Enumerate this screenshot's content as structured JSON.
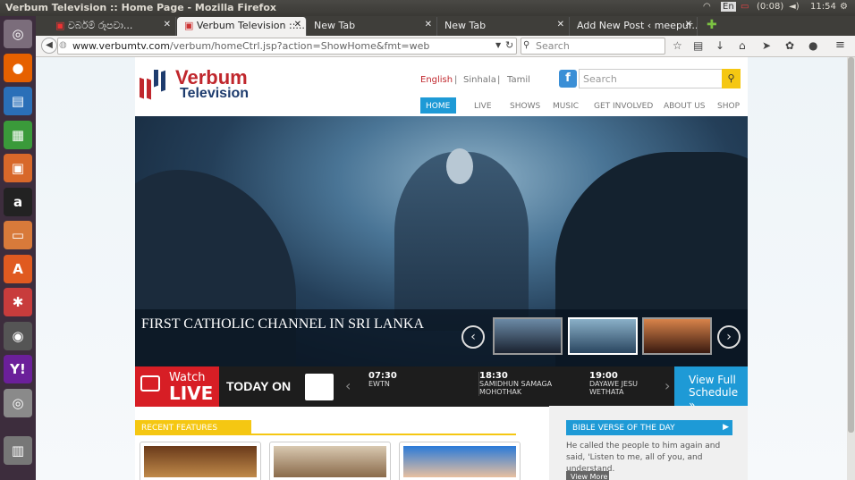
{
  "system": {
    "window_title": "Verbum Television :: Home Page - Mozilla Firefox",
    "keyboard": "En",
    "battery": "(0:08)",
    "time": "11:54"
  },
  "launcher": {
    "items": [
      {
        "icon": "ubuntu-dash-icon",
        "glyph": "◎",
        "color": "#7b6d7b"
      },
      {
        "icon": "firefox-icon",
        "glyph": "●",
        "color": "#e66000"
      },
      {
        "icon": "writer-icon",
        "glyph": "▤",
        "color": "#2a6fb8"
      },
      {
        "icon": "calc-icon",
        "glyph": "▦",
        "color": "#3a9a3a"
      },
      {
        "icon": "impress-icon",
        "glyph": "▣",
        "color": "#d8682a"
      },
      {
        "icon": "amazon-icon",
        "glyph": "a",
        "color": "#222222"
      },
      {
        "icon": "files-icon",
        "glyph": "▭",
        "color": "#d87a3a"
      },
      {
        "icon": "software-center-icon",
        "glyph": "A",
        "color": "#e05a20"
      },
      {
        "icon": "settings-icon",
        "glyph": "✱",
        "color": "#c83c3c"
      },
      {
        "icon": "webcam-icon",
        "glyph": "◉",
        "color": "#555555"
      },
      {
        "icon": "yahoo-mail-icon",
        "glyph": "Y!",
        "color": "#6b1f9a"
      },
      {
        "icon": "cdrom-icon",
        "glyph": "◎",
        "color": "#8a8a8a"
      },
      {
        "icon": "trash-icon",
        "glyph": "▥",
        "color": "#777777"
      }
    ]
  },
  "browser": {
    "tabs": [
      {
        "label": "වර්බම් රූපවා...",
        "active": false
      },
      {
        "label": "Verbum Television ::...",
        "active": true
      },
      {
        "label": "New Tab",
        "active": false
      },
      {
        "label": "New Tab",
        "active": false
      },
      {
        "label": "Add New Post ‹ meepur...",
        "active": false
      }
    ],
    "url_host": "www.verbumtv.com",
    "url_path": "/verbum/homeCtrl.jsp?action=ShowHome&fmt=web",
    "search_placeholder": "Search"
  },
  "site": {
    "logo_line1": "Verbum",
    "logo_line2": "Television",
    "languages": [
      "English",
      "Sinhala",
      "Tamil"
    ],
    "search_placeholder": "Search",
    "nav": [
      "HOME",
      "LIVE",
      "SHOWS",
      "MUSIC",
      "GET INVOLVED",
      "ABOUT US",
      "SHOP"
    ],
    "hero_title": "FIRST CATHOLIC CHANNEL IN SRI LANKA",
    "watch_label": "Watch",
    "live_label": "LIVE",
    "today_on": "TODAY ON",
    "schedule": [
      {
        "time": "07:30",
        "title": "EWTN"
      },
      {
        "time": "18:30",
        "title": "SAMIDHUN SAMAGA MOHOTHAK"
      },
      {
        "time": "19:00",
        "title": "DAYAWE JESU WETHATA"
      }
    ],
    "view_full_schedule": "View Full Schedule",
    "recent_features": "RECENT FEATURES",
    "bible_verse_heading": "BIBLE VERSE OF THE DAY",
    "bible_verse_text": "He called the people to him again and said, 'Listen to me, all of you, and understand.",
    "view_more": "View More"
  }
}
